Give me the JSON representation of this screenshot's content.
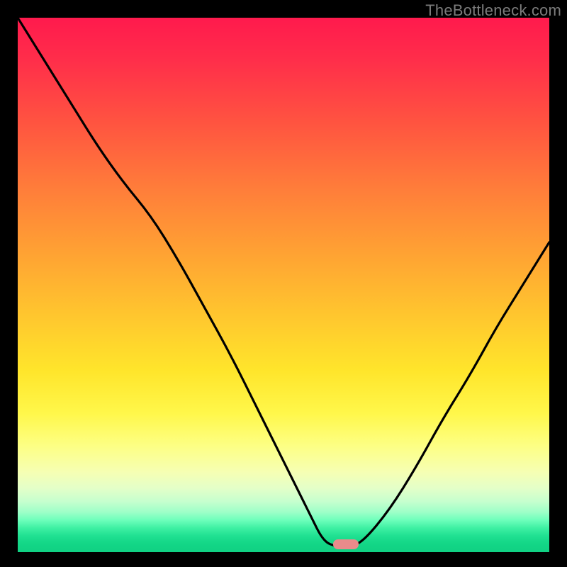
{
  "watermark": "TheBottleneck.com",
  "marker": {
    "x_frac": 0.617,
    "y_frac": 0.985
  },
  "colors": {
    "curve_stroke": "#000000",
    "marker_fill": "#e98b8b",
    "background": "#000000"
  },
  "chart_data": {
    "type": "line",
    "title": "",
    "xlabel": "",
    "ylabel": "",
    "xlim": [
      0,
      1
    ],
    "ylim": [
      0,
      1
    ],
    "series": [
      {
        "name": "bottleneck-curve",
        "x": [
          0.0,
          0.05,
          0.1,
          0.15,
          0.2,
          0.25,
          0.3,
          0.35,
          0.4,
          0.45,
          0.5,
          0.55,
          0.575,
          0.6,
          0.625,
          0.65,
          0.7,
          0.75,
          0.8,
          0.85,
          0.9,
          0.95,
          1.0
        ],
        "y": [
          1.0,
          0.92,
          0.84,
          0.76,
          0.69,
          0.63,
          0.55,
          0.46,
          0.37,
          0.27,
          0.17,
          0.07,
          0.02,
          0.01,
          0.01,
          0.02,
          0.08,
          0.16,
          0.25,
          0.33,
          0.42,
          0.5,
          0.58
        ]
      }
    ],
    "annotations": [
      {
        "type": "marker",
        "x": 0.617,
        "y": 0.015,
        "label": "optimal-point"
      }
    ]
  }
}
